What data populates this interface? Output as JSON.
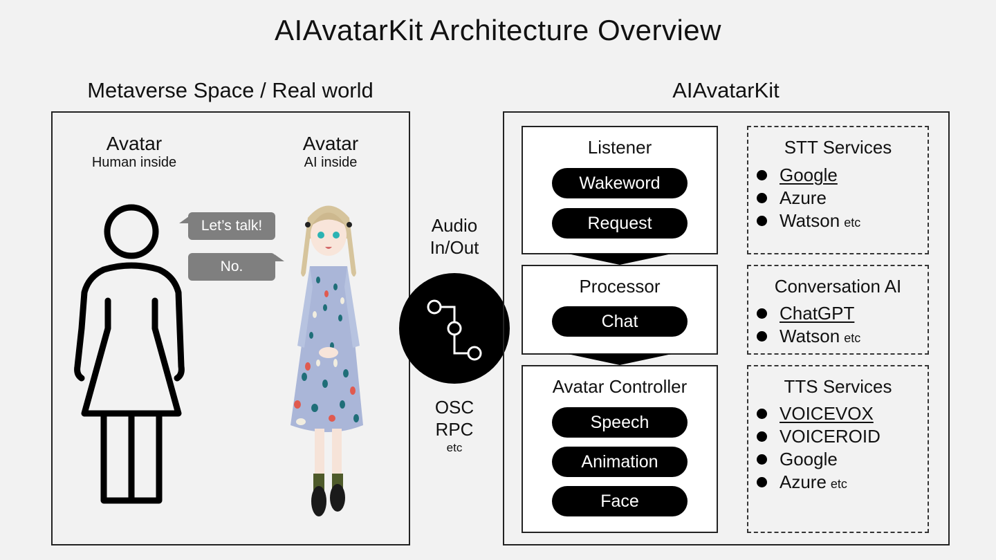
{
  "title": "AIAvatarKit Architecture Overview",
  "left_section": {
    "title": "Metaverse Space / Real world",
    "human_avatar": {
      "label": "Avatar",
      "sublabel": "Human inside",
      "icon": "person-outline-icon"
    },
    "ai_avatar": {
      "label": "Avatar",
      "sublabel": "AI inside",
      "image": "anime-girl-avatar"
    },
    "bubbles": [
      {
        "text": "Let’s talk!",
        "speaker": "human"
      },
      {
        "text": "No.",
        "speaker": "ai"
      }
    ]
  },
  "connector": {
    "top_lines": [
      "Audio",
      "In/Out"
    ],
    "bottom_lines": [
      "OSC",
      "RPC"
    ],
    "bottom_small": "etc",
    "icon": "flow-nodes-icon"
  },
  "right_section": {
    "title": "AIAvatarKit",
    "modules": [
      {
        "title": "Listener",
        "items": [
          "Wakeword",
          "Request"
        ]
      },
      {
        "title": "Processor",
        "items": [
          "Chat"
        ]
      },
      {
        "title": "Avatar Controller",
        "items": [
          "Speech",
          "Animation",
          "Face"
        ]
      }
    ],
    "services": [
      {
        "title": "STT Services",
        "items": [
          {
            "name": "Google",
            "underlined": true,
            "etc": ""
          },
          {
            "name": "Azure",
            "underlined": false,
            "etc": ""
          },
          {
            "name": "Watson",
            "underlined": false,
            "etc": "etc"
          }
        ]
      },
      {
        "title": "Conversation AI",
        "items": [
          {
            "name": "ChatGPT",
            "underlined": true,
            "etc": ""
          },
          {
            "name": "Watson",
            "underlined": false,
            "etc": "etc"
          }
        ]
      },
      {
        "title": "TTS Services",
        "items": [
          {
            "name": "VOICEVOX",
            "underlined": true,
            "etc": ""
          },
          {
            "name": "VOICEROID",
            "underlined": false,
            "etc": ""
          },
          {
            "name": "Google",
            "underlined": false,
            "etc": ""
          },
          {
            "name": "Azure",
            "underlined": false,
            "etc": "etc"
          }
        ]
      }
    ]
  },
  "colors": {
    "background": "#f2f2f2",
    "bubble": "#7f7f7f",
    "pill": "#000000",
    "module_bg": "#ffffff"
  }
}
